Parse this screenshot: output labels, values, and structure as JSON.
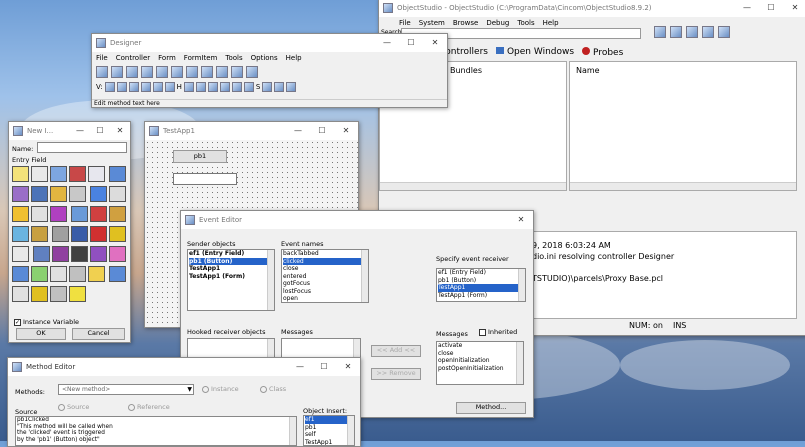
{
  "colors": {
    "selection": "#2563c9",
    "accent": "#ffe800"
  },
  "objectstudio": {
    "title": "ObjectStudio - ObjectStudio (C:\\ProgramData\\Cincom\\ObjectStudio8.9.2)",
    "menu": [
      "File",
      "System",
      "Browse",
      "Debug",
      "Tools",
      "Help"
    ],
    "search_label": "Search",
    "tabs": [
      {
        "icon": "controllers-icon",
        "label": "Controllers"
      },
      {
        "icon": "open-windows-icon",
        "label": "Open Windows"
      },
      {
        "icon": "probes-icon",
        "label": "Probes"
      }
    ],
    "col_bundles": "Bundles",
    "col_name": "Name",
    "log": [
      "9, 2018 6:03:24 AM",
      "dio.ini resolving controller Designer",
      "TSTUDIO)\\parcels\\Proxy Base.pcl"
    ],
    "status": [
      "NUM: on",
      "INS"
    ]
  },
  "designer": {
    "title": "Designer",
    "menu": [
      "File",
      "Controller",
      "Form",
      "FormItem",
      "Tools",
      "Options",
      "Help"
    ],
    "align_v": "V:",
    "align_h": "H",
    "align_s": "S",
    "status": "Edit method text here"
  },
  "newwin": {
    "title": "New I...",
    "name_label": "Name:",
    "type_label": "Entry Field",
    "instance_variable": "Instance Variable",
    "ok": "OK",
    "cancel": "Cancel"
  },
  "testapp": {
    "title": "TestApp1",
    "button_label": "pb1"
  },
  "event_editor": {
    "title": "Event Editor",
    "sender_label": "Sender objects",
    "sender_items": [
      "ef1 (Entry Field)",
      "pb1 (Button)",
      "TestApp1",
      "TestApp1 (Form)"
    ],
    "sender_selected": 1,
    "event_label": "Event names",
    "event_items": [
      "backTabbed",
      "clicked",
      "close",
      "entered",
      "gotFocus",
      "lostFocus",
      "open"
    ],
    "event_selected": 1,
    "receiver_label": "Specify event receiver",
    "receiver_items": [
      "ef1 (Entry Field)",
      "pb1 (Button)",
      "TestApp1",
      "TestApp1 (Form)"
    ],
    "receiver_selected": 2,
    "hooked_label": "Hooked receiver objects",
    "messages_label": "Messages",
    "add_btn": "<< Add <<",
    "remove_btn": ">> Remove",
    "messages2_label": "Messages",
    "inherited_label": "Inherited",
    "messages2_items": [
      "activate",
      "close",
      "openInitialization",
      "postOpenInitialization"
    ],
    "method_btn": "Method..."
  },
  "method_editor": {
    "title": "Method Editor",
    "methods_label": "Methods:",
    "methods_value": "<New method>",
    "instance_label": "Instance",
    "class_label": "Class",
    "source_label": "Source",
    "source_radio": "Source",
    "reference_radio": "Reference",
    "source_text": [
      "pb1Clicked",
      "  \"This method will be called when",
      "   the 'clicked' event is triggered",
      "   by the 'pb1' (Button) object\""
    ],
    "object_insert_label": "Object Insert:",
    "object_insert_items": [
      "ef1",
      "pb1",
      "self",
      "TestApp1"
    ],
    "object_insert_selected": 0
  }
}
